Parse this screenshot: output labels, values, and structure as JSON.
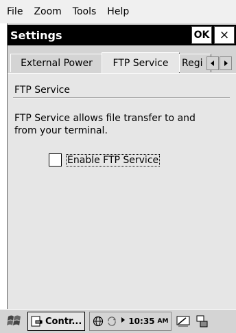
{
  "menubar": {
    "items": [
      "File",
      "Zoom",
      "Tools",
      "Help"
    ]
  },
  "window": {
    "title": "Settings",
    "ok_label": "OK",
    "close_label": "×"
  },
  "tabs": [
    {
      "label": "External Power",
      "active": false
    },
    {
      "label": "FTP Service",
      "active": true
    },
    {
      "label": "Regi",
      "active": false
    }
  ],
  "content": {
    "group_label": "FTP Service",
    "description": "FTP Service allows file transfer to and from your terminal.",
    "checkbox_label": "Enable FTP Service",
    "checkbox_checked": false
  },
  "taskbar": {
    "task_label": "Contr...",
    "time": "10:35",
    "ampm": "AM"
  }
}
